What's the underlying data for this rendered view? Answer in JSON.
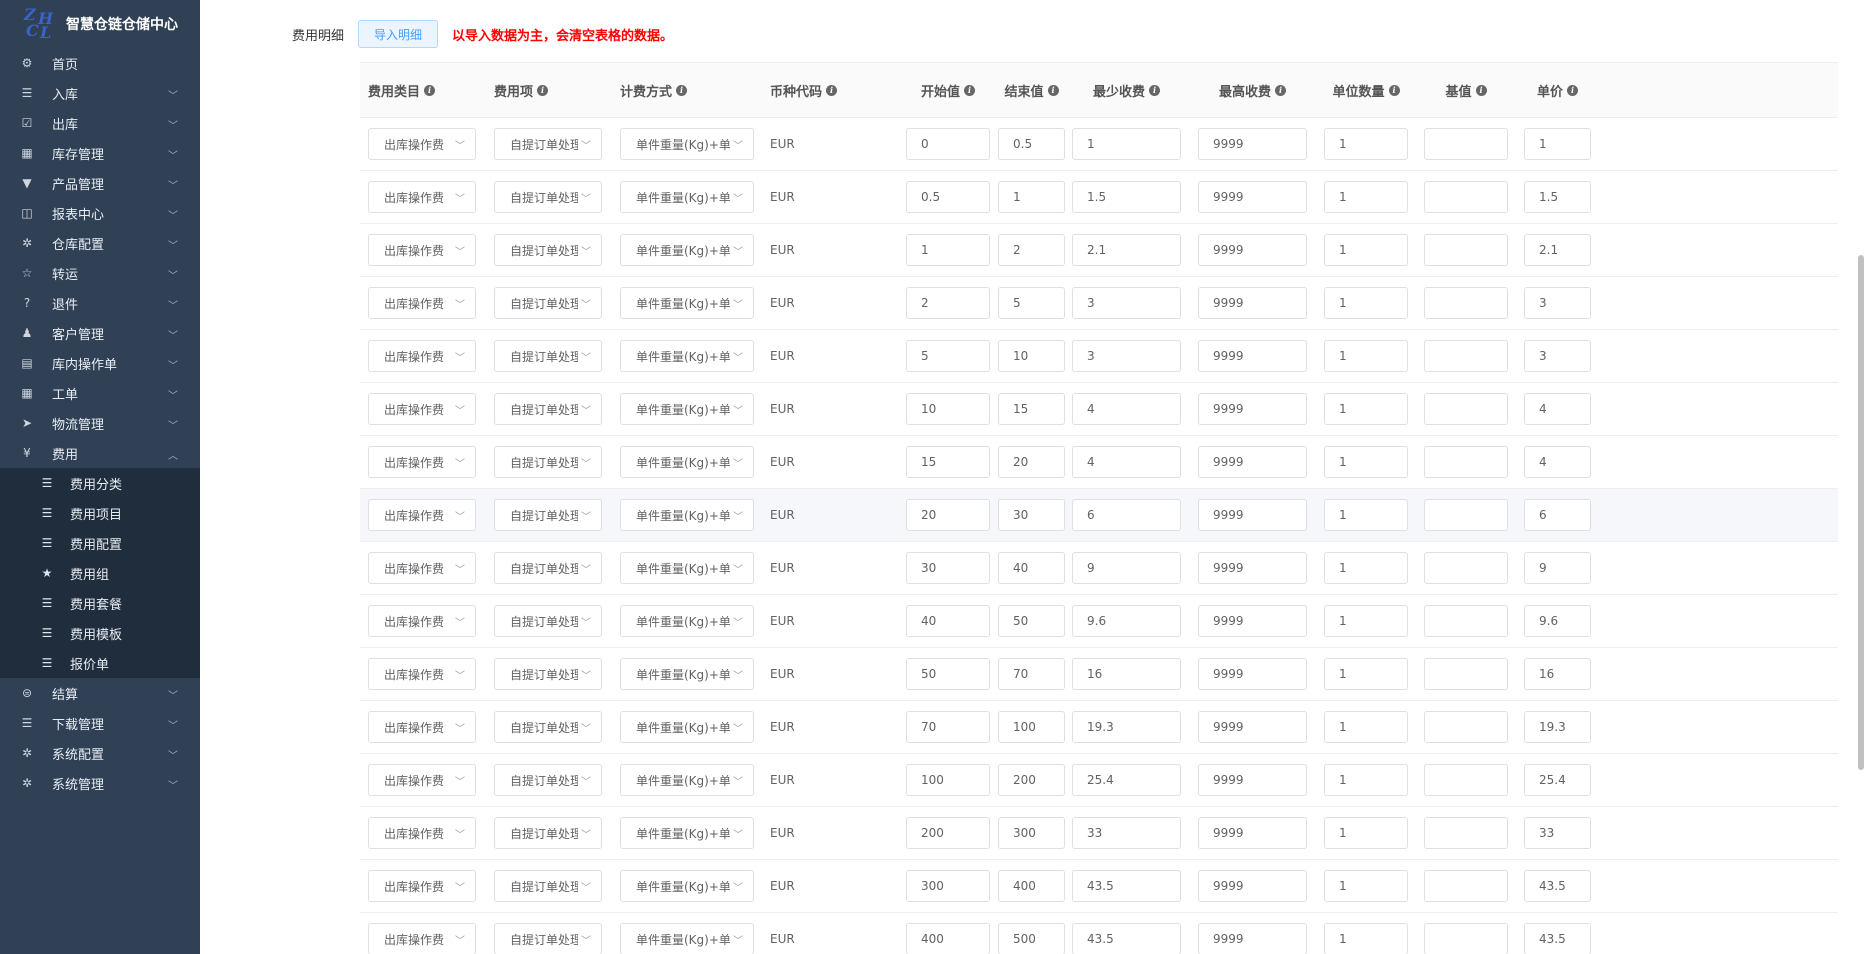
{
  "app": {
    "title": "智慧仓链仓储中心",
    "logo_letters": [
      "Z",
      "H",
      "C",
      "L"
    ]
  },
  "sidebar": {
    "items": [
      {
        "label": "首页",
        "icon": "home-icon",
        "glyph": "⚙",
        "expandable": false
      },
      {
        "label": "入库",
        "icon": "list-icon",
        "glyph": "☰",
        "expandable": true
      },
      {
        "label": "出库",
        "icon": "checkbox-icon",
        "glyph": "☑",
        "expandable": true
      },
      {
        "label": "库存管理",
        "icon": "inventory-icon",
        "glyph": "▦",
        "expandable": true
      },
      {
        "label": "产品管理",
        "icon": "shirt-icon",
        "glyph": "▼",
        "expandable": true
      },
      {
        "label": "报表中心",
        "icon": "report-icon",
        "glyph": "◫",
        "expandable": true
      },
      {
        "label": "仓库配置",
        "icon": "gear-icon",
        "glyph": "✲",
        "expandable": true
      },
      {
        "label": "转运",
        "icon": "star-outline-icon",
        "glyph": "☆",
        "expandable": true
      },
      {
        "label": "退件",
        "icon": "question-circle-icon",
        "glyph": "?",
        "expandable": true
      },
      {
        "label": "客户管理",
        "icon": "user-icon",
        "glyph": "♟",
        "expandable": true
      },
      {
        "label": "库内操作单",
        "icon": "document-icon",
        "glyph": "▤",
        "expandable": true
      },
      {
        "label": "工单",
        "icon": "grid-icon",
        "glyph": "▦",
        "expandable": true
      },
      {
        "label": "物流管理",
        "icon": "send-icon",
        "glyph": "➤",
        "expandable": true
      },
      {
        "label": "费用",
        "icon": "yen-icon",
        "glyph": "¥",
        "expandable": true,
        "open": true
      }
    ],
    "fee_submenu": [
      {
        "label": "费用分类",
        "icon": "list-icon",
        "glyph": "☰"
      },
      {
        "label": "费用项目",
        "icon": "list-icon",
        "glyph": "☰"
      },
      {
        "label": "费用配置",
        "icon": "list-icon",
        "glyph": "☰"
      },
      {
        "label": "费用组",
        "icon": "star-icon",
        "glyph": "★"
      },
      {
        "label": "费用套餐",
        "icon": "list-icon",
        "glyph": "☰"
      },
      {
        "label": "费用模板",
        "icon": "list-icon",
        "glyph": "☰"
      },
      {
        "label": "报价单",
        "icon": "list-icon",
        "glyph": "☰"
      }
    ],
    "items_after": [
      {
        "label": "结算",
        "icon": "settlement-icon",
        "glyph": "⊜",
        "expandable": true
      },
      {
        "label": "下载管理",
        "icon": "list-icon",
        "glyph": "☰",
        "expandable": true
      },
      {
        "label": "系统配置",
        "icon": "gear-icon",
        "glyph": "✲",
        "expandable": true
      },
      {
        "label": "系统管理",
        "icon": "gear-icon",
        "glyph": "✲",
        "expandable": true
      }
    ]
  },
  "main": {
    "section_label": "费用明细",
    "import_button": "导入明细",
    "warning": "以导入数据为主，会清空表格的数据。",
    "columns": [
      "费用类目",
      "费用项",
      "计费方式",
      "币种代码",
      "开始值",
      "结束值",
      "最少收费",
      "最高收费",
      "单位数量",
      "基值",
      "单价"
    ],
    "row_defaults": {
      "category": "出库操作费",
      "item": "自提订单处理费",
      "method": "单件重量(Kg)+单件[",
      "currency": "EUR",
      "max_fee": "9999",
      "unit_qty": "1",
      "base": ""
    },
    "rows": [
      {
        "start": "0",
        "end": "0.5",
        "min_fee": "1",
        "price": "1"
      },
      {
        "start": "0.5",
        "end": "1",
        "min_fee": "1.5",
        "price": "1.5"
      },
      {
        "start": "1",
        "end": "2",
        "min_fee": "2.1",
        "price": "2.1"
      },
      {
        "start": "2",
        "end": "5",
        "min_fee": "3",
        "price": "3"
      },
      {
        "start": "5",
        "end": "10",
        "min_fee": "3",
        "price": "3"
      },
      {
        "start": "10",
        "end": "15",
        "min_fee": "4",
        "price": "4"
      },
      {
        "start": "15",
        "end": "20",
        "min_fee": "4",
        "price": "4"
      },
      {
        "start": "20",
        "end": "30",
        "min_fee": "6",
        "price": "6",
        "highlighted": true
      },
      {
        "start": "30",
        "end": "40",
        "min_fee": "9",
        "price": "9"
      },
      {
        "start": "40",
        "end": "50",
        "min_fee": "9.6",
        "price": "9.6"
      },
      {
        "start": "50",
        "end": "70",
        "min_fee": "16",
        "price": "16"
      },
      {
        "start": "70",
        "end": "100",
        "min_fee": "19.3",
        "price": "19.3"
      },
      {
        "start": "100",
        "end": "200",
        "min_fee": "25.4",
        "price": "25.4"
      },
      {
        "start": "200",
        "end": "300",
        "min_fee": "33",
        "price": "33"
      },
      {
        "start": "300",
        "end": "400",
        "min_fee": "43.5",
        "price": "43.5"
      },
      {
        "start": "400",
        "end": "500",
        "min_fee": "43.5",
        "price": "43.5"
      }
    ]
  },
  "colors": {
    "sidebar_bg": "#304156",
    "submenu_bg": "#1f2d3d",
    "accent": "#409eff",
    "warning": "#ff0000"
  }
}
